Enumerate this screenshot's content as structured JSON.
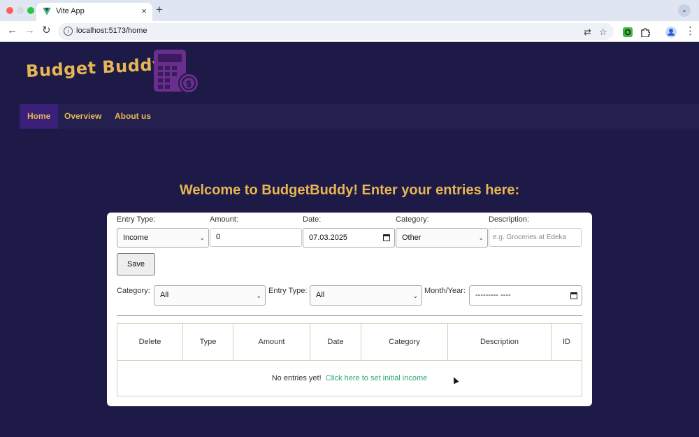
{
  "browser": {
    "tab_title": "Vite App",
    "tab_close": "×",
    "new_tab": "+",
    "tab_menu": "⌄",
    "back": "←",
    "forward": "→",
    "reload": "↻",
    "url": "localhost:5173/home",
    "info": "i",
    "translate": "⇄",
    "bookmark": "☆",
    "menu": "⋮"
  },
  "app": {
    "brand": "Budget Buddy",
    "nav": [
      "Home",
      "Overview",
      "About us"
    ],
    "welcome": "Welcome to BudgetBuddy! Enter your entries here:",
    "form": {
      "entry_type_label": "Entry Type:",
      "entry_type_value": "Income",
      "amount_label": "Amount:",
      "amount_value": "0",
      "date_label": "Date:",
      "date_value": "07.03.2025",
      "category_label": "Category:",
      "category_value": "Other",
      "description_label": "Description:",
      "description_placeholder": "e.g. Groceries at Edeka",
      "save_label": "Save"
    },
    "filters": {
      "category_label": "Category:",
      "category_value": "All",
      "entry_type_label": "Entry Type:",
      "entry_type_value": "All",
      "month_year_label": "Month/Year:",
      "month_year_value": "--------- ----"
    },
    "table": {
      "columns": [
        "Delete",
        "Type",
        "Amount",
        "Date",
        "Category",
        "Description",
        "ID"
      ],
      "empty_text": "No entries yet!",
      "empty_link": "Click here to set initial income"
    }
  },
  "colors": {
    "background": "#1e1a48",
    "accent": "#e6b652",
    "nav_active": "#3a1f78",
    "link": "#2faa6e"
  },
  "icons": [
    "vue-logo-icon",
    "info-icon",
    "translate-icon",
    "star-icon",
    "extension-icon",
    "profile-icon",
    "calculator-dollar-icon",
    "calendar-icon"
  ]
}
